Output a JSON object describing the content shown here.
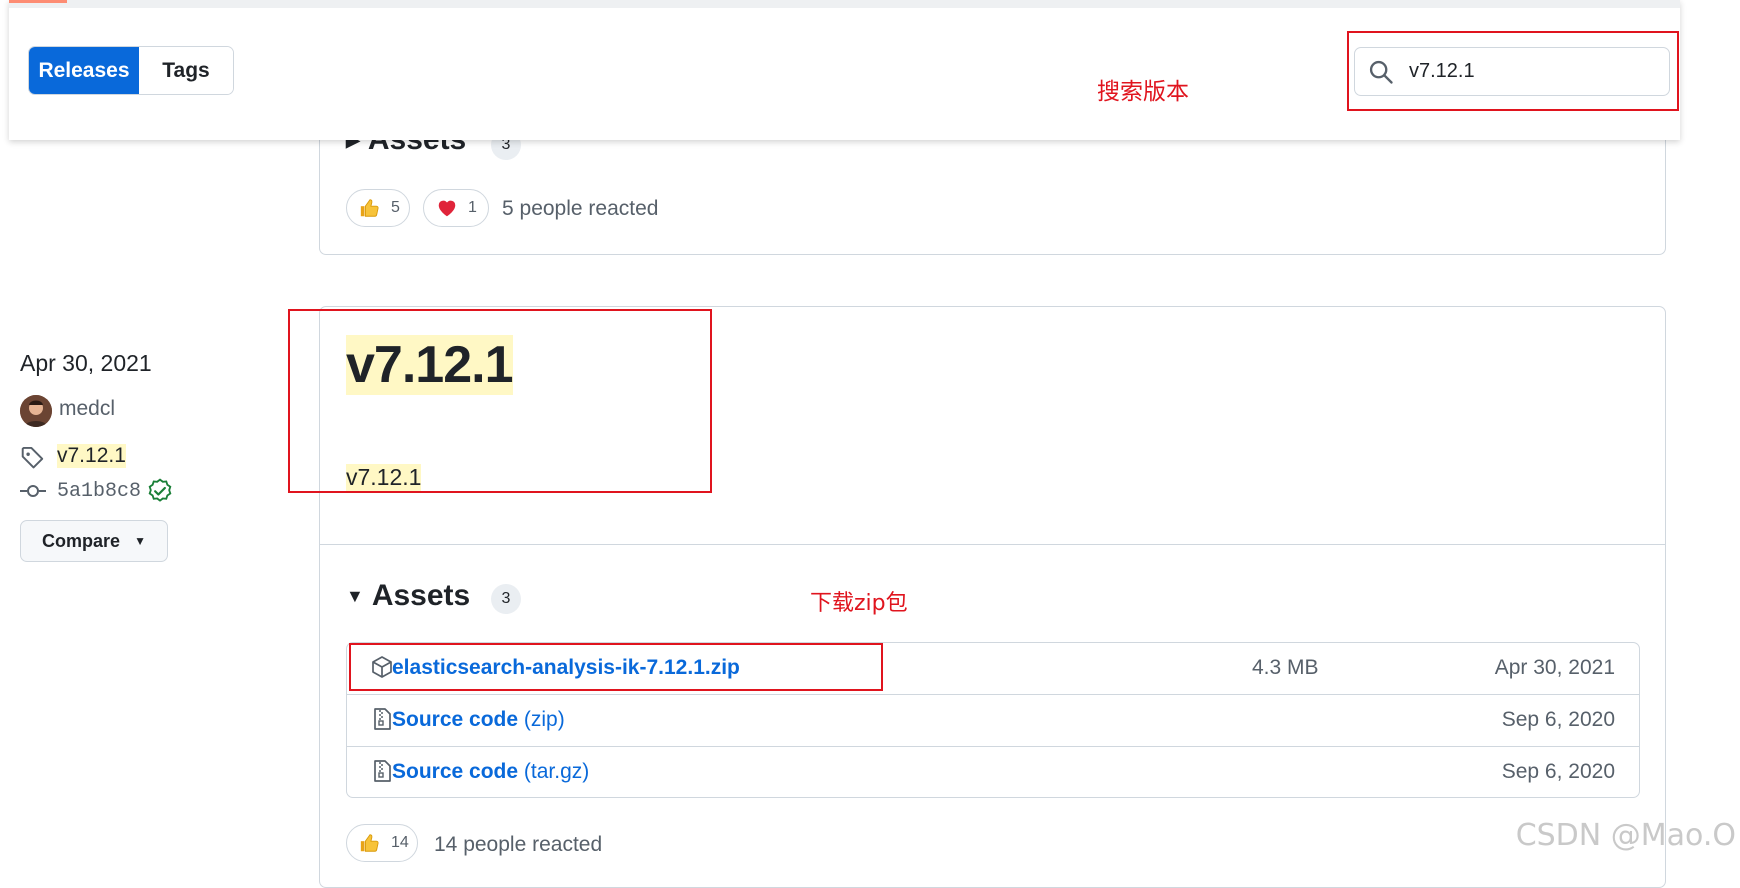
{
  "topbar": {
    "tabs": [
      {
        "label": "Releases",
        "active": true
      },
      {
        "label": "Tags",
        "active": false
      }
    ],
    "search": {
      "value": "v7.12.1",
      "placeholder": ""
    },
    "annotation_search": "搜索版本"
  },
  "prev_release": {
    "assets_label": "Assets",
    "assets_count": "3",
    "reactions": [
      {
        "emoji": "thumbs-up",
        "count": "5"
      },
      {
        "emoji": "heart",
        "count": "1"
      }
    ],
    "reacted_text": "5 people reacted"
  },
  "sidebar": {
    "date": "Apr 30, 2021",
    "author": "medcl",
    "tag": "v7.12.1",
    "commit": "5a1b8c8",
    "compare_label": "Compare"
  },
  "release": {
    "title": "v7.12.1",
    "body": "v7.12.1",
    "assets_label": "Assets",
    "assets_count": "3",
    "annotation_download": "下载zip包",
    "assets": [
      {
        "name": "elasticsearch-analysis-ik-7.12.1.zip",
        "ext": "",
        "size": "4.3 MB",
        "date": "Apr 30, 2021",
        "icon": "package-icon"
      },
      {
        "name": "Source code",
        "ext": "(zip)",
        "size": "",
        "date": "Sep 6, 2020",
        "icon": "file-zip-icon"
      },
      {
        "name": "Source code",
        "ext": "(tar.gz)",
        "size": "",
        "date": "Sep 6, 2020",
        "icon": "file-zip-icon"
      }
    ],
    "reactions": [
      {
        "emoji": "thumbs-up",
        "count": "14"
      }
    ],
    "reacted_text": "14 people reacted"
  },
  "colors": {
    "accent": "#0969da",
    "annotation": "#e0141e",
    "highlight": "#fff8c5",
    "verified": "#1a7f37"
  },
  "watermark": "CSDN @Mao.O"
}
